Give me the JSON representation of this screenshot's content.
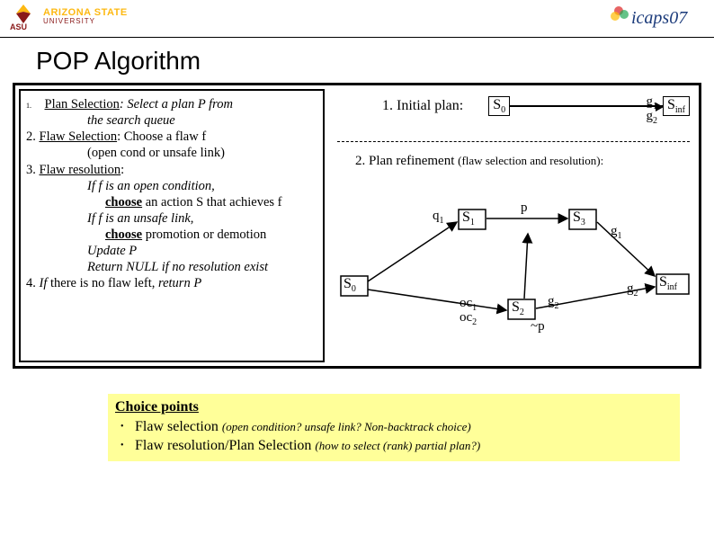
{
  "header": {
    "asu_line1": "ARIZONA STATE",
    "asu_line2": "UNIVERSITY",
    "icaps": "icaps07"
  },
  "title": "POP Algorithm",
  "algo": {
    "step1_num": "1.",
    "step1_label": "Plan Selection",
    "step1_rest": ": Select a plan P from",
    "step1_line2": "the search queue",
    "step2_prefix": "2. ",
    "step2_label": "Flaw Selection",
    "step2_rest": ": Choose a flaw f",
    "step2_line2": "(open cond or unsafe link)",
    "step3_prefix": "3. ",
    "step3_label": "Flaw resolution",
    "step3_colon": ":",
    "step3_if1": "If  f is an open condition,",
    "step3_choose1a": "choose",
    "step3_choose1b": " an action S that achieves f",
    "step3_if2": "If f is an unsafe link,",
    "step3_choose2a": "choose",
    "step3_choose2b": "  promotion or demotion",
    "step3_update": "Update P",
    "step3_return": "Return NULL if no resolution exist",
    "step4_prefix": "4. ",
    "step4_if": "If",
    "step4_mid": " there is no flaw left, ",
    "step4_return": "return P"
  },
  "right": {
    "initial_label": "1. Initial plan:",
    "s0": "S",
    "s0_sub": "0",
    "g1": "g",
    "g1_sub": "1",
    "g2": "g",
    "g2_sub": "2",
    "sinf": "S",
    "sinf_sub": "inf",
    "refine_prefix": "2. Plan refinement ",
    "refine_suffix": "(flaw selection and resolution):",
    "q1": "q",
    "q1_sub": "1",
    "s1": "S",
    "s1_sub": "1",
    "p": "p",
    "s3": "S",
    "s3_sub": "3",
    "oc1": "oc",
    "oc1_sub": "1",
    "oc2": "oc",
    "oc2_sub": "2",
    "s2": "S",
    "s2_sub": "2",
    "notp": "~p"
  },
  "choice": {
    "title": "Choice points",
    "b1a": "Flaw selection ",
    "b1b": "(open condition? unsafe link? Non-backtrack choice)",
    "b2a": "Flaw resolution/Plan Selection ",
    "b2b": "(how to select (rank) partial plan?)"
  }
}
